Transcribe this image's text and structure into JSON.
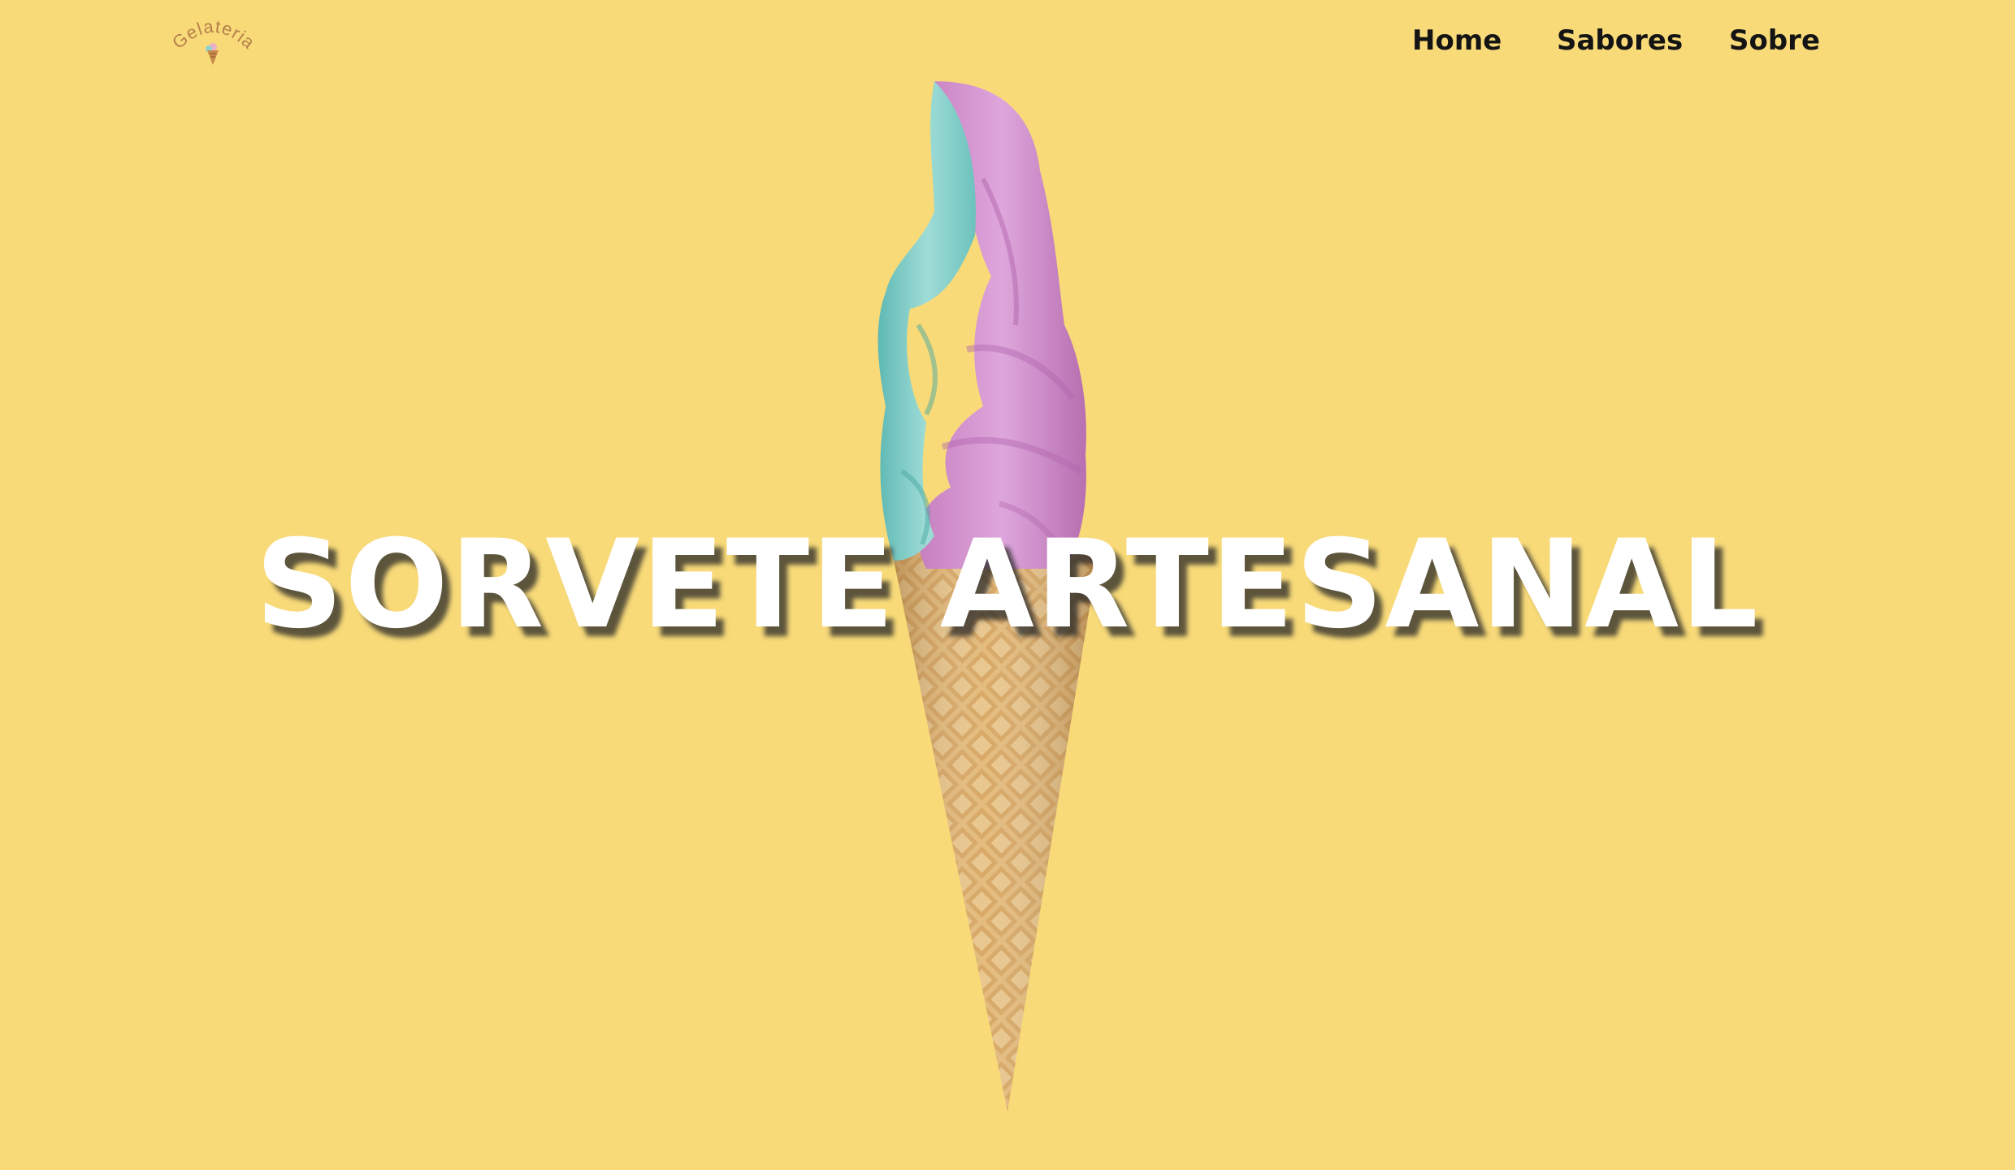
{
  "brand": {
    "logo_text": "Gelateria",
    "accent_color": "#b6804a",
    "background_color": "#f8da79"
  },
  "nav": {
    "items": [
      {
        "label": "Home"
      },
      {
        "label": "Sabores"
      },
      {
        "label": "Sobre"
      }
    ]
  },
  "hero": {
    "title": "SORVETE ARTESANAL",
    "image": "soft-serve-ice-cream-cone-teal-pink"
  }
}
